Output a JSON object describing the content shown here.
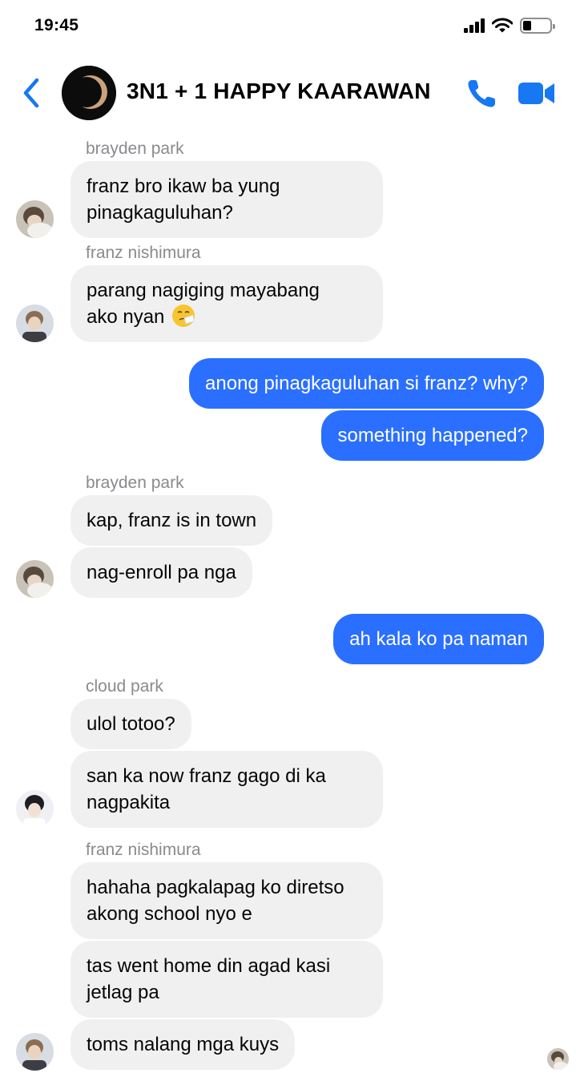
{
  "status_bar": {
    "time": "19:45",
    "battery_level": 0.3
  },
  "header": {
    "title": "3N1 + 1 HAPPY KAARAWAN"
  },
  "messages": {
    "m1": {
      "sender": "brayden park",
      "lines": [
        "franz bro ikaw ba yung",
        "pinagkaguluhan?"
      ]
    },
    "m2": {
      "sender": "franz nishimura",
      "lines": [
        "parang nagiging mayabang",
        "ako nyan"
      ],
      "emoji": "sneezing-face"
    },
    "m3": {
      "text": "anong pinagkaguluhan si franz? why?"
    },
    "m4": {
      "text": "something happened?"
    },
    "m5": {
      "sender": "brayden park",
      "text": "kap, franz is in town"
    },
    "m6": {
      "text": "nag-enroll pa nga"
    },
    "m7": {
      "text": "ah kala ko pa naman"
    },
    "m8": {
      "sender": "cloud park",
      "text": "ulol totoo?"
    },
    "m9": {
      "lines": [
        "san ka now franz gago di ka",
        "nagpakita"
      ]
    },
    "m10": {
      "sender": "franz nishimura",
      "lines": [
        "hahaha pagkalapag ko diretso",
        "akong school nyo e"
      ]
    },
    "m11": {
      "lines": [
        "tas went home din agad kasi",
        "jetlag pa"
      ]
    },
    "m12": {
      "text": "toms nalang mga kuys"
    }
  },
  "colors": {
    "outgoing_bubble": "#2a6fff",
    "incoming_bubble": "#f0f0f0",
    "accent": "#1877f2"
  }
}
